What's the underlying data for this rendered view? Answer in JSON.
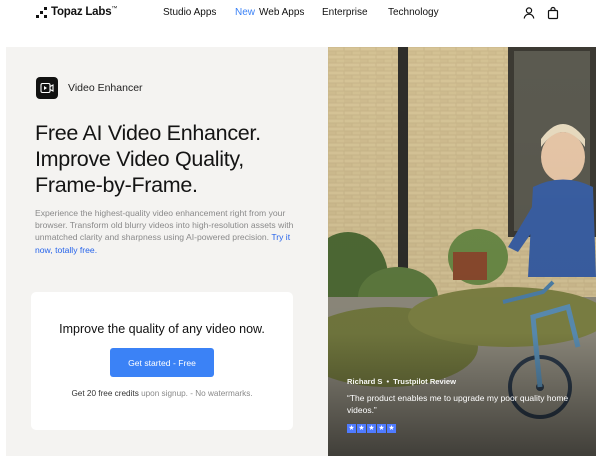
{
  "nav": {
    "brand": "Topaz Labs",
    "brand_tm": "™",
    "links": [
      {
        "label": "Studio Apps",
        "prefix": ""
      },
      {
        "label": "Web Apps",
        "prefix": "New"
      },
      {
        "label": "Enterprise",
        "prefix": ""
      },
      {
        "label": "Technology",
        "prefix": ""
      }
    ],
    "icons": [
      "user-icon",
      "shopping-bag-icon"
    ]
  },
  "hero": {
    "product_name": "Video Enhancer",
    "headline_lines": [
      "Free AI Video Enhancer.",
      "Improve Video Quality,",
      "Frame-by-Frame."
    ],
    "description": "Experience the highest-quality video enhancement right from your browser. Transform old blurry videos into high-resolution assets with unmatched clarity and sharpness using AI-powered precision.",
    "description_link": "Try it now, totally free."
  },
  "cta": {
    "title": "Improve the quality of any video now.",
    "button_label": "Get started - Free",
    "note_strong": "Get 20 free credits",
    "note_muted": " upon signup. - No watermarks."
  },
  "review": {
    "author": "Richard S",
    "separator": "•",
    "source": "Trustpilot Review",
    "quote": "“The product enables me to upgrade my poor quality home videos.”",
    "stars": 5,
    "star_color": "#4f7bff"
  },
  "colors": {
    "accent": "#3b82f6",
    "panel_bg": "#f4f3f1",
    "link": "#2563eb"
  }
}
